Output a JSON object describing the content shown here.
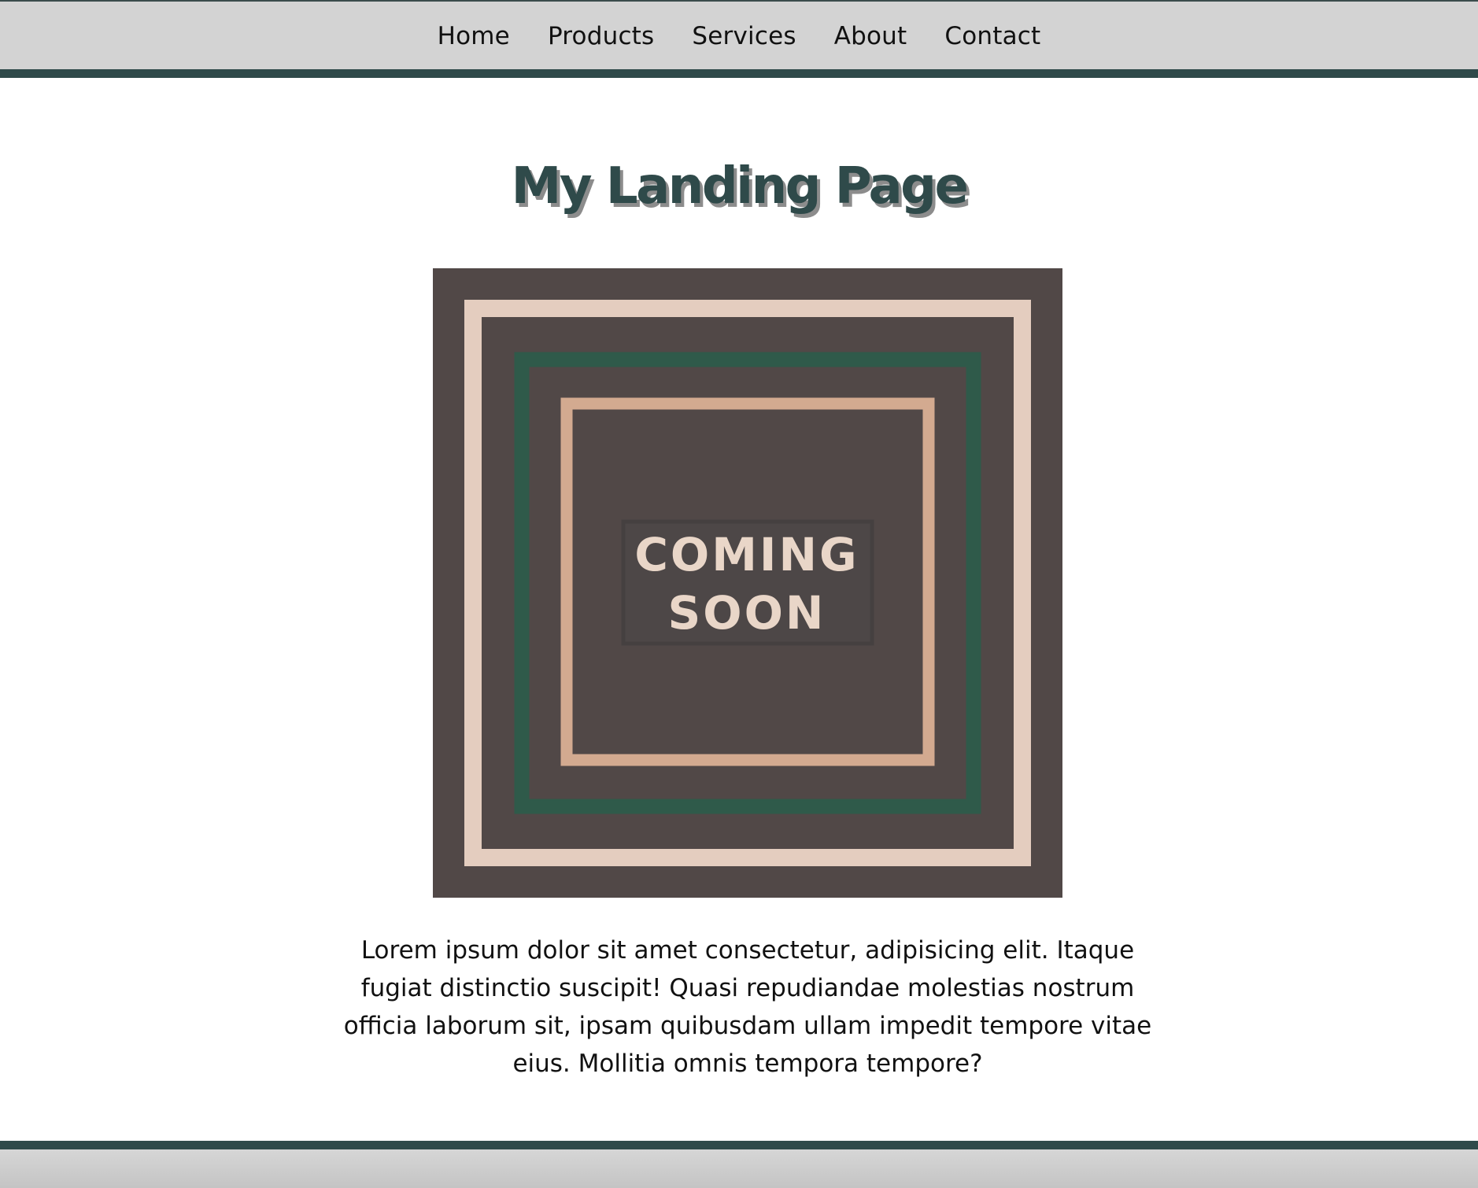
{
  "nav": {
    "items": [
      {
        "label": "Home"
      },
      {
        "label": "Products"
      },
      {
        "label": "Services"
      },
      {
        "label": "About"
      },
      {
        "label": "Contact"
      }
    ]
  },
  "main": {
    "title": "My Landing Page",
    "hero_image": {
      "line1": "COMING",
      "line2": "SOON",
      "colors": {
        "background": "#514847",
        "outer_frame": "#e4cdbf",
        "middle_frame": "#2f5a4a",
        "inner_frame": "#d3aa90",
        "label_box": "#4a4444",
        "text": "#e9d6c8"
      }
    },
    "description": "Lorem ipsum dolor sit amet consectetur, adipisicing elit. Itaque fugiat distinctio suscipit! Quasi repudiandae molestias nostrum officia laborum sit, ipsam quibusdam ullam impedit tempore vitae eius. Mollitia omnis tempora tempore?"
  },
  "theme": {
    "accent": "#2f4a4a",
    "nav_background": "#d3d3d3"
  }
}
